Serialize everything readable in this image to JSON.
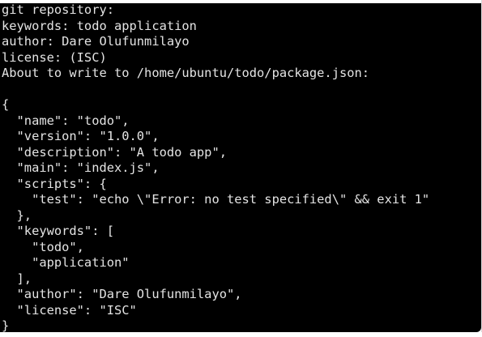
{
  "terminal": {
    "lines": [
      "git repository:",
      "keywords: todo application",
      "author: Dare Olufunmilayo",
      "license: (ISC)",
      "About to write to /home/ubuntu/todo/package.json:",
      "",
      "{",
      "  \"name\": \"todo\",",
      "  \"version\": \"1.0.0\",",
      "  \"description\": \"A todo app\",",
      "  \"main\": \"index.js\",",
      "  \"scripts\": {",
      "    \"test\": \"echo \\\"Error: no test specified\\\" && exit 1\"",
      "  },",
      "  \"keywords\": [",
      "    \"todo\",",
      "    \"application\"",
      "  ],",
      "  \"author\": \"Dare Olufunmilayo\",",
      "  \"license\": \"ISC\"",
      "}"
    ],
    "colors": {
      "background": "#000000",
      "text": "#e4e4e4"
    }
  }
}
